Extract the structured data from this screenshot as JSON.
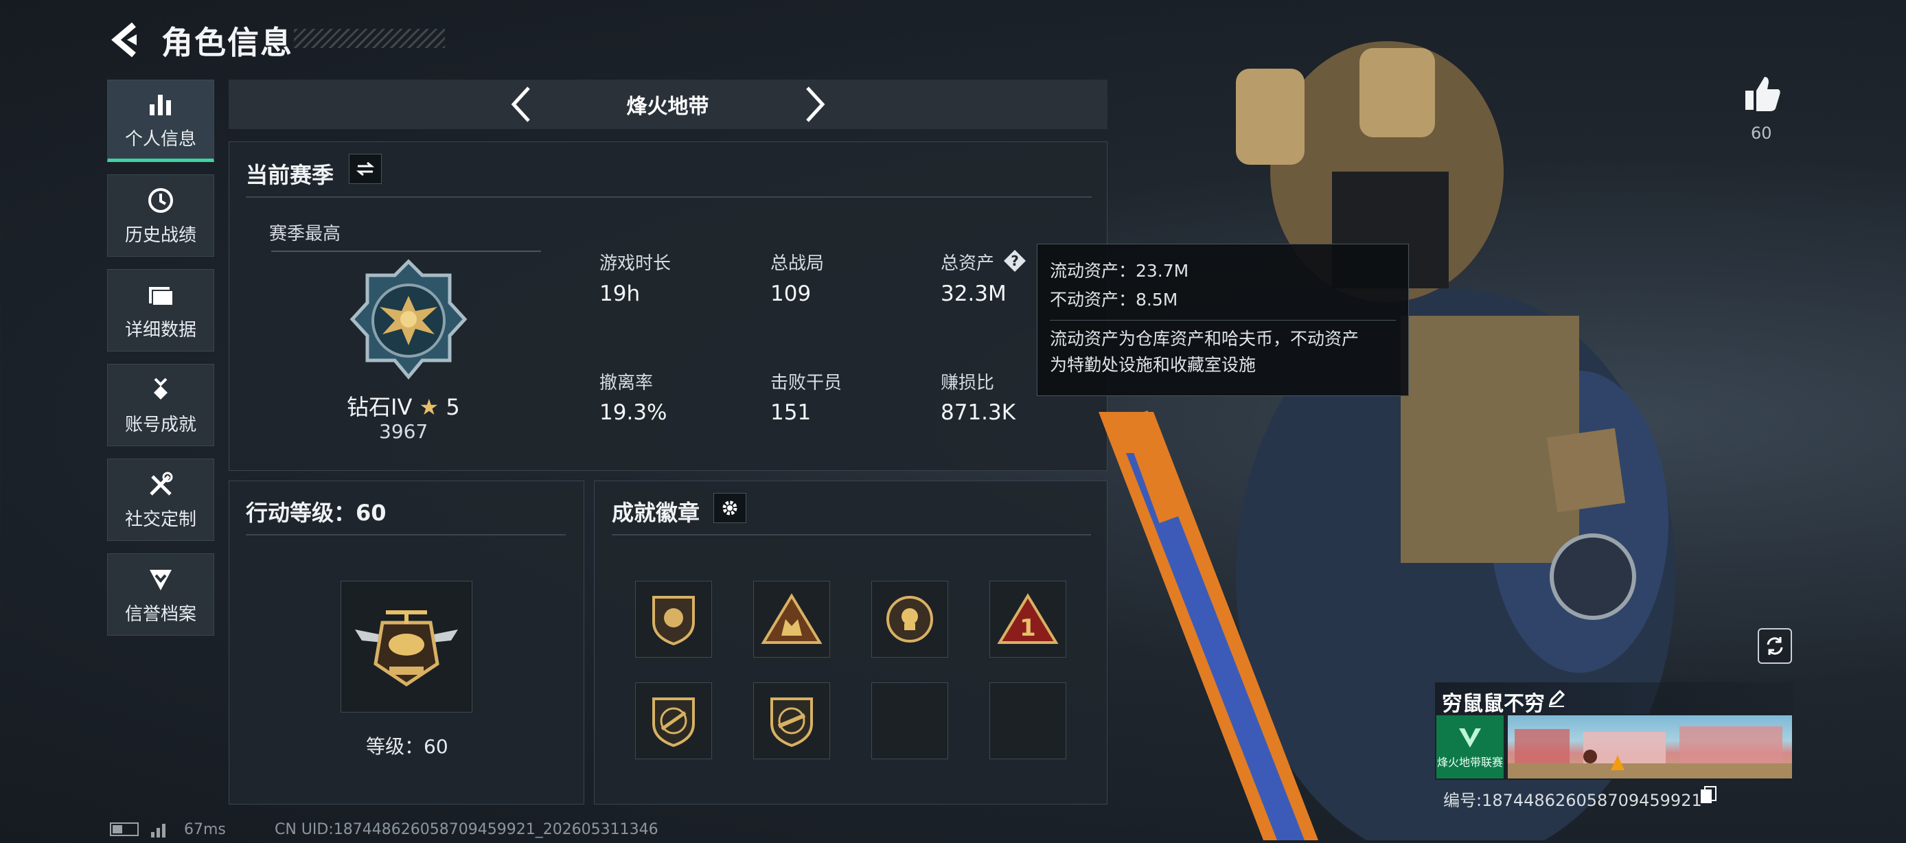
{
  "header": {
    "title": "角色信息"
  },
  "nav": {
    "items": [
      {
        "label": "个人信息",
        "icon": "bar-chart-icon"
      },
      {
        "label": "历史战绩",
        "icon": "clock-icon"
      },
      {
        "label": "详细数据",
        "icon": "folder-icon"
      },
      {
        "label": "账号成就",
        "icon": "medal-icon"
      },
      {
        "label": "社交定制",
        "icon": "tools-icon"
      },
      {
        "label": "信誉档案",
        "icon": "shield-check-icon"
      }
    ]
  },
  "mode": {
    "title": "烽火地带"
  },
  "season": {
    "title": "当前赛季",
    "best_label": "赛季最高",
    "rank_name": "钻石IV",
    "rank_stars": "5",
    "rank_score": "3967",
    "stats": [
      {
        "label": "游戏时长",
        "value": "19h"
      },
      {
        "label": "总战局",
        "value": "109"
      },
      {
        "label": "总资产",
        "value": "32.3M"
      },
      {
        "label": "撤离率",
        "value": "19.3%"
      },
      {
        "label": "击败干员",
        "value": "151"
      },
      {
        "label": "赚损比",
        "value": "871.3K"
      }
    ]
  },
  "tooltip": {
    "line1": "流动资产：23.7M",
    "line2": "不动资产：8.5M",
    "desc1": "流动资产为仓库资产和哈夫币，不动资产",
    "desc2": "为特勤处设施和收藏室设施"
  },
  "action_level": {
    "title": "行动等级：60",
    "level_text": "等级：60"
  },
  "achievements": {
    "title": "成就徽章",
    "badges": [
      "lion-shield",
      "team-triangle",
      "skull-circle",
      "number-one-triangle",
      "gun-shield",
      "rifle-shield",
      "empty",
      "empty"
    ]
  },
  "right": {
    "like_count": "60",
    "player_name": "穷鼠鼠不穷",
    "card_text": "烽火地带联赛",
    "uid_label": "编号:1874486260587094599​21"
  },
  "footer": {
    "ping": "67ms",
    "uid": "CN UID:1874486260587094599​21_202605311346"
  },
  "colors": {
    "accent": "#3fd3a0",
    "panel": "#20262d"
  }
}
